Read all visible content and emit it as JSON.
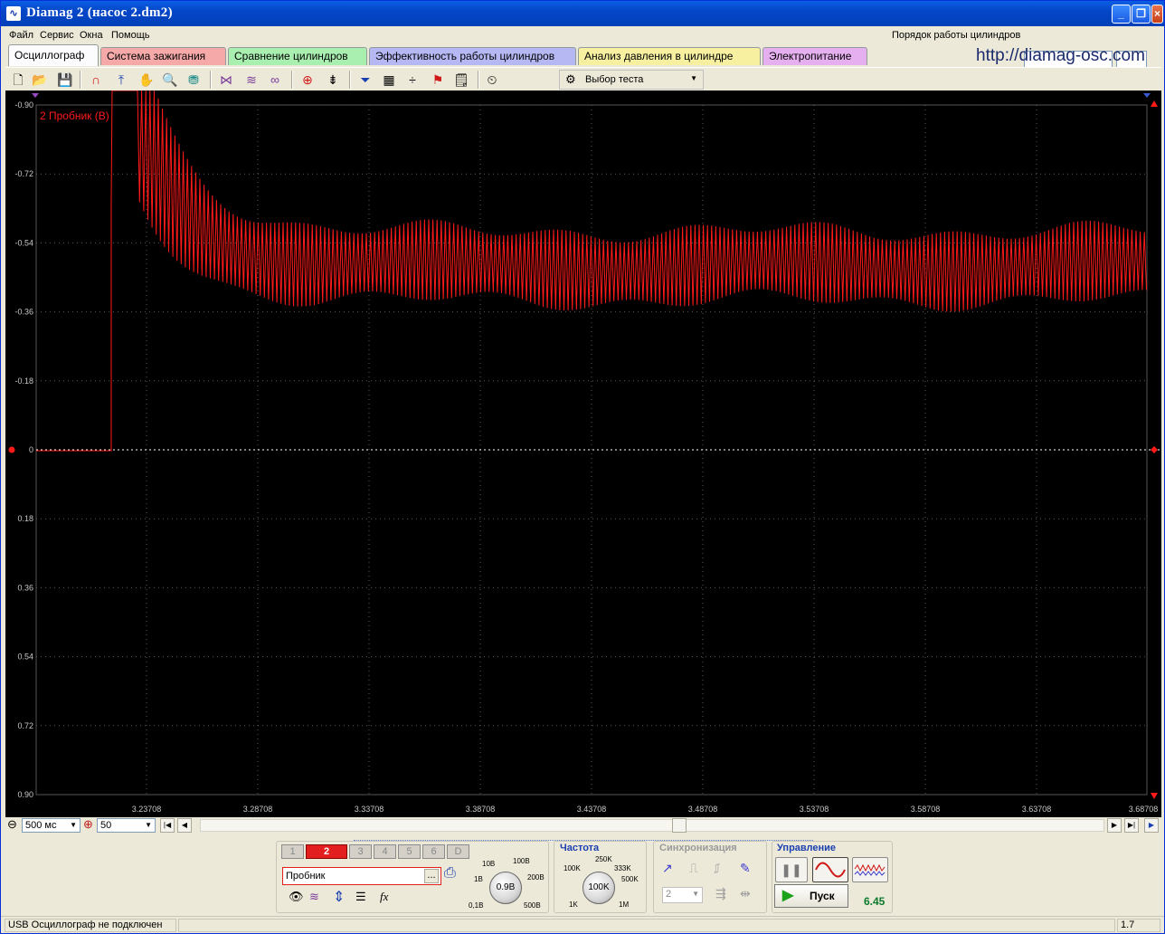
{
  "window": {
    "title": "Diamag 2 (насос 2.dm2)",
    "app_icon": "waveform-icon",
    "controls": [
      "minimize-icon",
      "restore-icon",
      "close-icon"
    ]
  },
  "menu": {
    "items": [
      "Файл",
      "Сервис",
      "Окна",
      "Помощь"
    ],
    "right_text": "Порядок работы цилиндров",
    "url_text": "http://diamag-osc.com"
  },
  "tabs": [
    {
      "label": "Осциллограф",
      "color": "#fcfcfe",
      "active": true
    },
    {
      "label": "Система зажигания",
      "color": "#f6a9a9"
    },
    {
      "label": "Сравнение цилиндров",
      "color": "#a9f0b0"
    },
    {
      "label": "Эффективность работы цилиндров",
      "color": "#b6b8f4"
    },
    {
      "label": "Анализ давления в цилиндре",
      "color": "#f6f0a0"
    },
    {
      "label": "Электропитание",
      "color": "#e6b0f0"
    }
  ],
  "toolbar": {
    "test_select_label": "Выбор теста",
    "icons": [
      "new-file-icon",
      "open-folder-icon",
      "save-icon",
      "measure-arc-icon",
      "cursor-icon",
      "hand-icon",
      "zoom-icon",
      "filter-icon",
      "scale-x-icon",
      "waves-icon",
      "overlay-icon",
      "auto-trigger-icon",
      "zero-level-icon",
      "funnel-icon",
      "grid-icon",
      "split-icon",
      "flag-icon",
      "notes-icon",
      "auto-icon"
    ]
  },
  "scope": {
    "channel_label": "2 Пробник (В)",
    "y_ticks": [
      "-0.90",
      "-0.72",
      "-0.54",
      "-0.36",
      "-0.18",
      "0",
      "0.18",
      "0.36",
      "0.54",
      "0.72",
      "0.90"
    ],
    "x_ticks": [
      "3.23708",
      "3.28708",
      "3.33708",
      "3.38708",
      "3.43708",
      "3.48708",
      "3.53708",
      "3.58708",
      "3.63708",
      "3.68708"
    ],
    "trace_color": "#ff1a1a"
  },
  "timebase": {
    "time_per_div": "500 мс",
    "zoom": "50"
  },
  "channels": {
    "buttons": [
      "1",
      "2",
      "3",
      "4",
      "5",
      "6",
      "D"
    ],
    "active": "2",
    "probe_name": "Пробник",
    "probe_browse": "..."
  },
  "voltage_knob": {
    "value": "0.9В",
    "marks": [
      "10В",
      "100В",
      "1В",
      "200В",
      "0,1В",
      "500В"
    ]
  },
  "frequency": {
    "title": "Частота",
    "value": "100K",
    "marks": [
      "250K",
      "100K",
      "333K",
      "500K",
      "1K",
      "1M"
    ]
  },
  "sync": {
    "title": "Синхронизация",
    "channel": "2"
  },
  "control": {
    "title": "Управление",
    "run_label": "Пуск",
    "value": "6.45"
  },
  "status": {
    "message": "USB Осциллограф не подключен",
    "version": "1.7"
  }
}
